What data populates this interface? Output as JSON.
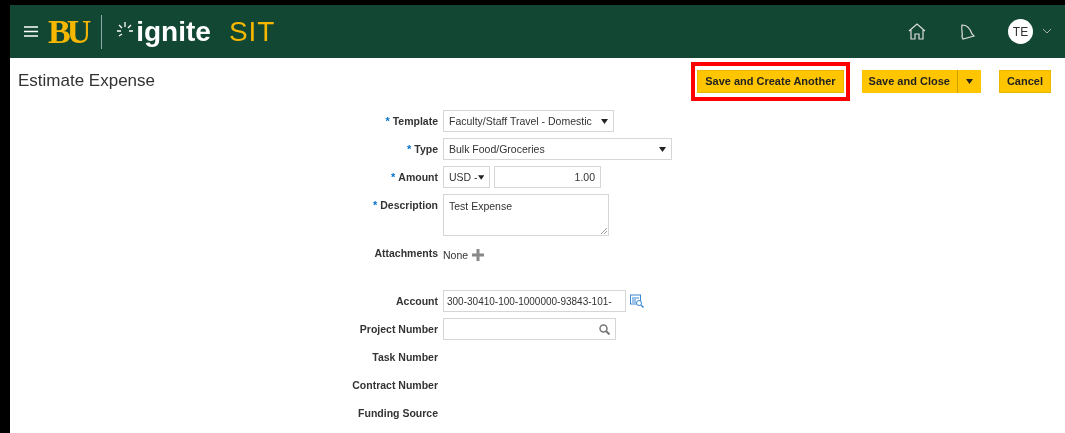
{
  "header": {
    "brand_mark": "BU",
    "app_name": "ignite",
    "environment": "SIT",
    "avatar": "TE"
  },
  "page": {
    "title": "Estimate Expense"
  },
  "actions": [
    {
      "label": "Save and Create Another",
      "kind": "button",
      "highlighted": true
    },
    {
      "label": "Save and Close",
      "kind": "split",
      "highlighted": false
    },
    {
      "label": "Cancel",
      "kind": "button",
      "highlighted": false
    }
  ],
  "fields": [
    {
      "label": "Template",
      "required_mark": "*",
      "kind": "select",
      "value": "Faculty/Staff Travel - Domestic"
    },
    {
      "label": "Type",
      "required_mark": "*",
      "kind": "wide_select",
      "value": "Bulk Food/Groceries"
    },
    {
      "label": "Amount",
      "required_mark": "*",
      "kind": "amount",
      "currency": "USD -",
      "value": "1.00"
    },
    {
      "label": "Description",
      "required_mark": "*",
      "kind": "textarea",
      "value": "Test Expense"
    },
    {
      "label": "Attachments",
      "kind": "attachments",
      "value": "None"
    },
    {
      "label": "Account",
      "kind": "lookup",
      "value": "300-30410-100-1000000-93843-101-"
    },
    {
      "label": "Project Number",
      "kind": "search"
    },
    {
      "label": "Task Number",
      "kind": "label"
    },
    {
      "label": "Contract Number",
      "kind": "label"
    },
    {
      "label": "Funding Source",
      "kind": "label"
    }
  ]
}
